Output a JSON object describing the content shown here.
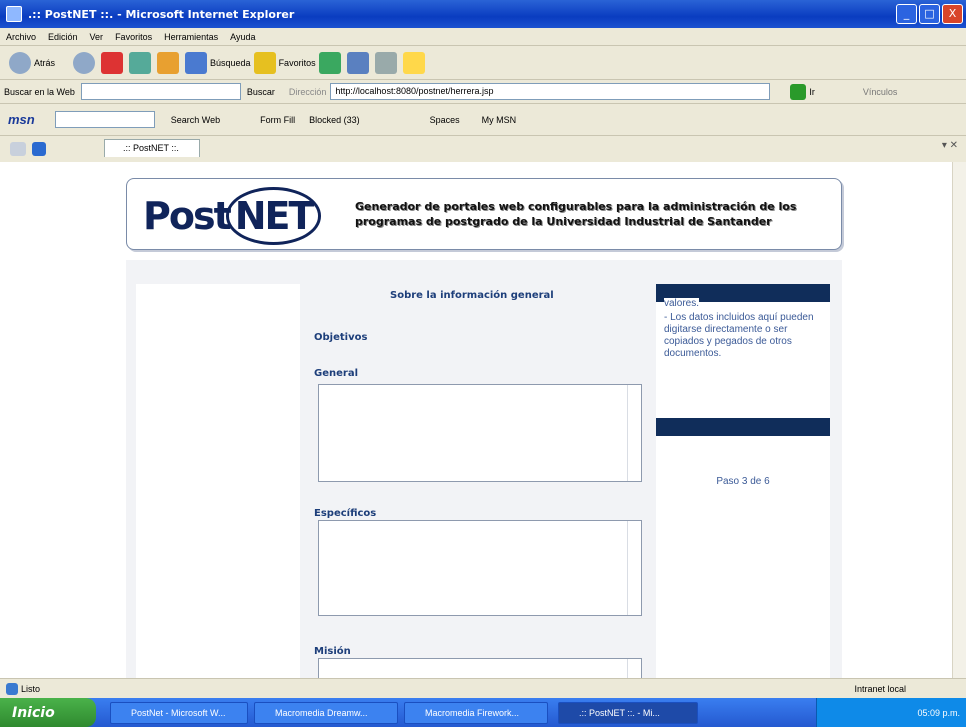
{
  "window": {
    "title": ".:: PostNET ::. - Microsoft Internet Explorer",
    "min": "_",
    "max": "□",
    "close": "X"
  },
  "menu": [
    "Archivo",
    "Edición",
    "Ver",
    "Favoritos",
    "Herramientas",
    "Ayuda"
  ],
  "toolbar": {
    "back": "Atrás",
    "search": "Búsqueda",
    "favorites": "Favoritos"
  },
  "search_bar": {
    "label": "Buscar en la Web",
    "button": "Buscar",
    "address_label": "Dirección",
    "url": "http://localhost:8080/postnet/herrera.jsp",
    "go": "Ir",
    "links": "Vínculos"
  },
  "msn_bar": {
    "brand": "msn",
    "search_web": "Search Web",
    "form_fill": "Form Fill",
    "blocked": "Blocked (33)",
    "spaces": "Spaces",
    "my_msn": "My MSN"
  },
  "tab": {
    "label": ".:: PostNET ::."
  },
  "banner": {
    "logo_a": "Post",
    "logo_b": "NET",
    "tagline": "Generador de portales web configurables para la administración de los programas de postgrado de la Universidad Industrial de Santander"
  },
  "main": {
    "section_title": "Sobre la información general",
    "objetivos": "Objetivos",
    "general": "General",
    "especificos": "Específicos",
    "mision": "Misión"
  },
  "sidebar": {
    "info_top": "valores.",
    "info_text": "- Los datos incluidos aquí pueden digitarse directamente o ser copiados y pegados de otros documentos.",
    "step": "Paso 3 de 6"
  },
  "status": {
    "text": "Listo",
    "zone": "Intranet local"
  },
  "taskbar": {
    "start": "Inicio",
    "tasks": [
      "PostNet - Microsoft W...",
      "Macromedia Dreamw...",
      "Macromedia Firework...",
      ".:: PostNET ::. - Mi..."
    ],
    "clock": "05:09 p.m."
  }
}
